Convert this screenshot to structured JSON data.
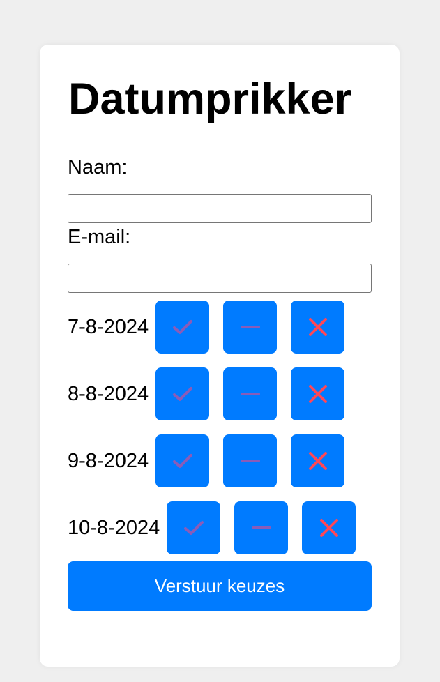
{
  "app": {
    "title": "Datumprikker"
  },
  "form": {
    "name_label": "Naam:",
    "name_value": "",
    "email_label": "E-mail:",
    "email_value": ""
  },
  "dates": [
    {
      "label": "7-8-2024"
    },
    {
      "label": "8-8-2024"
    },
    {
      "label": "9-8-2024"
    },
    {
      "label": "10-8-2024"
    }
  ],
  "options": {
    "yes_icon": "check-icon",
    "maybe_icon": "minus-icon",
    "no_icon": "cross-icon"
  },
  "submit": {
    "label": "Verstuur keuzes"
  },
  "colors": {
    "accent": "#007bff",
    "check": "#8a5cb8",
    "minus": "#8a5cb8",
    "cross": "#ff4757",
    "background": "#efefef",
    "card": "#ffffff"
  }
}
